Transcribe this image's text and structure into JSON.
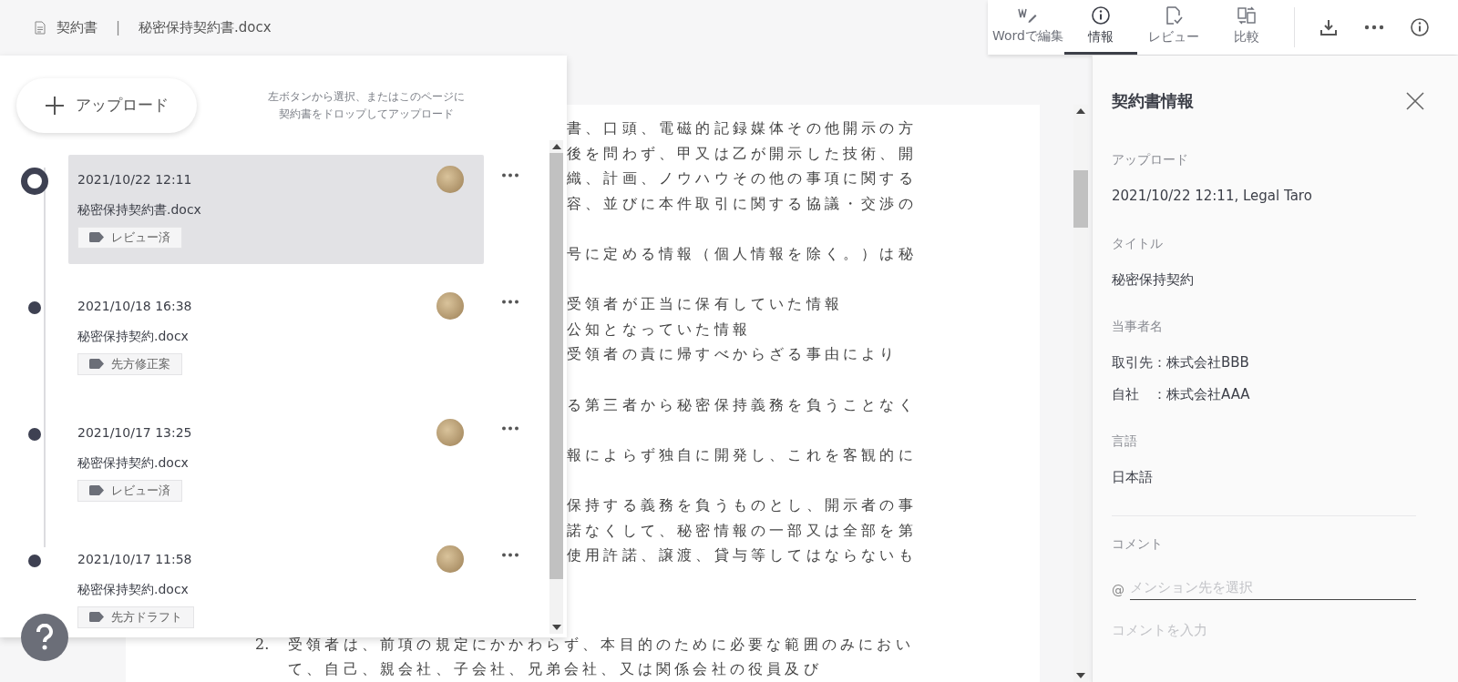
{
  "breadcrumb": {
    "section": "契約書",
    "separator": "|",
    "file": "秘密保持契約書.docx"
  },
  "toolbar": {
    "tabs": [
      {
        "label": "Wordで編集",
        "selected": false
      },
      {
        "label": "情報",
        "selected": true
      },
      {
        "label": "レビュー",
        "selected": false
      },
      {
        "label": "比較",
        "selected": false
      }
    ]
  },
  "history": {
    "upload_button": "アップロード",
    "hint_lines": [
      "左ボタンから選択、またはこのページに",
      "契約書をドロップしてアップロード"
    ],
    "versions": [
      {
        "datetime": "2021/10/22 12:11",
        "filename": "秘密保持契約書.docx",
        "tag": "レビュー済",
        "selected": true
      },
      {
        "datetime": "2021/10/18 16:38",
        "filename": "秘密保持契約.docx",
        "tag": "先方修正案",
        "selected": false
      },
      {
        "datetime": "2021/10/17 13:25",
        "filename": "秘密保持契約.docx",
        "tag": "レビュー済",
        "selected": false
      },
      {
        "datetime": "2021/10/17 11:58",
        "filename": "秘密保持契約.docx",
        "tag": "先方ドラフト",
        "selected": false
      }
    ]
  },
  "document": {
    "paragraphs": [
      {
        "kind": "fragment",
        "lines": [
          "書、口頭、電磁的記録媒体その他開示の方",
          "後を問わず、甲又は乙が開示した技術、開",
          "織、計画、ノウハウその他の事項に関する",
          "容、並びに本件取引に関する協議・交渉の"
        ]
      },
      {
        "kind": "fragment",
        "lines": [
          "号に定める情報（個人情報を除く。）は秘"
        ]
      },
      {
        "kind": "fragment",
        "lines": [
          "受領者が正当に保有していた情報",
          "公知となっていた情報",
          "受領者の責に帰すべからざる事由により"
        ]
      },
      {
        "kind": "fragment",
        "lines": [
          "る第三者から秘密保持義務を負うことなく"
        ]
      },
      {
        "kind": "fragment",
        "lines": [
          "報によらず独自に開発し、これを客観的に"
        ]
      },
      {
        "kind": "fragment",
        "lines": [
          "保持する義務を負うものとし、開示者の事",
          "諾なくして、秘密情報の一部又は全部を第",
          "使用許諾、譲渡、貸与等してはならないも"
        ]
      },
      {
        "kind": "full",
        "number": "2.",
        "lines": [
          "受領者は、前項の規定にかかわらず、本目的のために必要な範囲のみにおい",
          "て、自己、親会社、子会社、兄弟会社、又は関係会社の役員及び"
        ]
      }
    ]
  },
  "info_panel": {
    "title": "契約書情報",
    "fields": [
      {
        "label": "アップロード",
        "values": [
          "2021/10/22 12:11, Legal Taro"
        ]
      },
      {
        "label": "タイトル",
        "values": [
          "秘密保持契約"
        ]
      },
      {
        "label": "当事者名",
        "values": [
          "取引先：株式会社BBB",
          "自社　：株式会社AAA"
        ]
      },
      {
        "label": "言語",
        "values": [
          "日本語"
        ]
      }
    ],
    "comment": {
      "label": "コメント",
      "mention_prefix": "@",
      "mention_placeholder": "メンション先を選択",
      "comment_placeholder": "コメントを入力"
    }
  }
}
